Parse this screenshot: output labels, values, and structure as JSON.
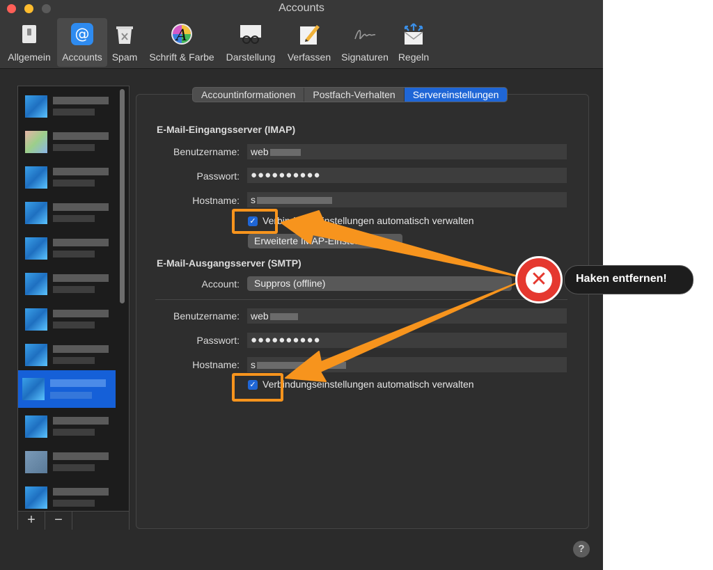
{
  "window": {
    "title": "Accounts"
  },
  "toolbar": [
    {
      "label": "Allgemein",
      "icon": "switch-icon"
    },
    {
      "label": "Accounts",
      "icon": "at-sign-icon"
    },
    {
      "label": "Spam",
      "icon": "trash-icon"
    },
    {
      "label": "Schrift & Farbe",
      "icon": "font-color-icon"
    },
    {
      "label": "Darstellung",
      "icon": "glasses-icon"
    },
    {
      "label": "Verfassen",
      "icon": "pencil-icon"
    },
    {
      "label": "Signaturen",
      "icon": "signature-icon"
    },
    {
      "label": "Regeln",
      "icon": "rules-icon"
    }
  ],
  "sidebar": {
    "add_label": "+",
    "remove_label": "−"
  },
  "tabs": [
    "Accountinformationen",
    "Postfach-Verhalten",
    "Servereinstellungen"
  ],
  "imap": {
    "heading": "E-Mail-Eingangsserver (IMAP)",
    "username_label": "Benutzername:",
    "username_value": "web",
    "password_label": "Passwort:",
    "password_value": "●●●●●●●●●●",
    "hostname_label": "Hostname:",
    "hostname_value": "s",
    "auto_label": "Verbindungseinstellungen automatisch verwalten",
    "auto_checked": true,
    "advanced_button": "Erweiterte IMAP-Einstellungen"
  },
  "smtp": {
    "heading": "E-Mail-Ausgangsserver (SMTP)",
    "account_label": "Account:",
    "account_value": "Suppros (offline)",
    "username_label": "Benutzername:",
    "username_value": "web",
    "password_label": "Passwort:",
    "password_value": "●●●●●●●●●●",
    "hostname_label": "Hostname:",
    "hostname_value": "s",
    "auto_label": "Verbindungseinstellungen automatisch verwalten",
    "auto_checked": true
  },
  "help": {
    "label": "?"
  },
  "annotation": {
    "text": "Haken entfernen!",
    "accent": "#f7941d",
    "badge": "#e5382f"
  }
}
